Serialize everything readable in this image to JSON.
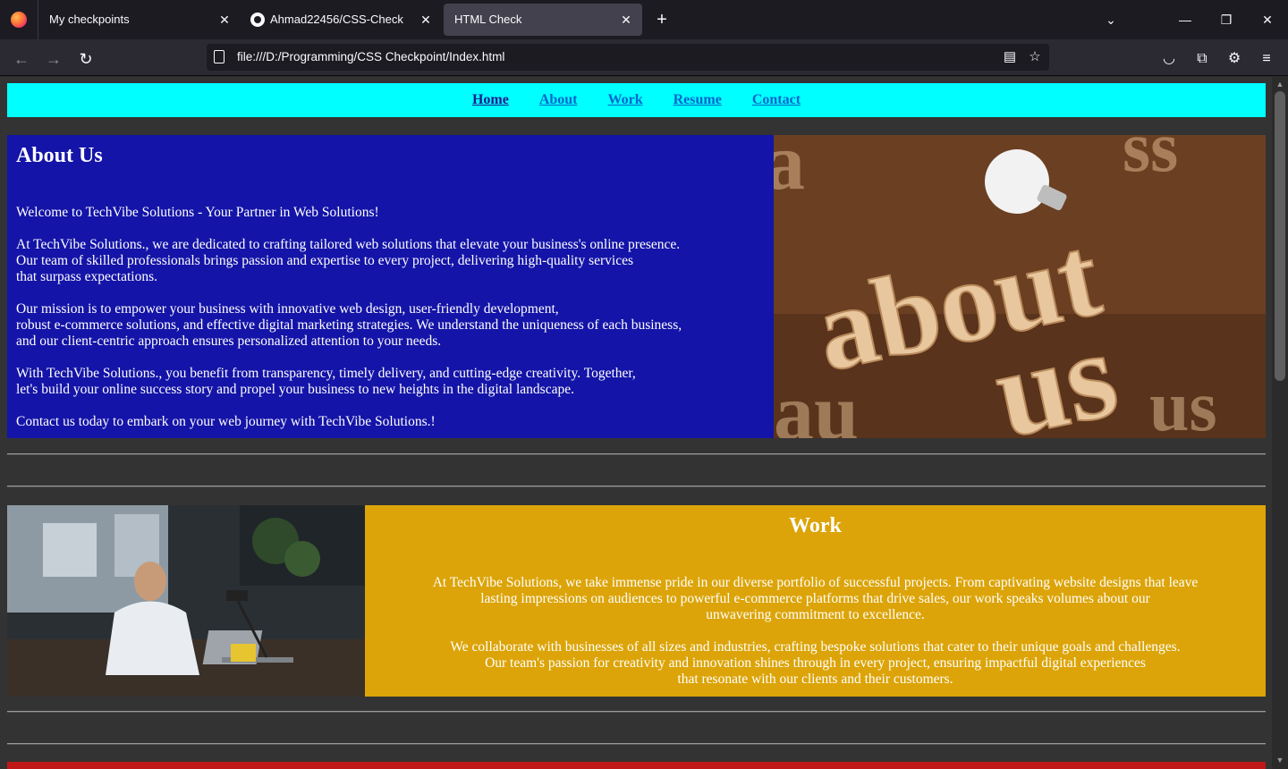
{
  "browser": {
    "tabs": [
      {
        "title": "My checkpoints"
      },
      {
        "title": "Ahmad22456/CSS-Check"
      },
      {
        "title": "HTML Check"
      }
    ],
    "url": "file:///D:/Programming/CSS Checkpoint/Index.html"
  },
  "site": {
    "nav": [
      "Home",
      "About",
      "Work",
      "Resume",
      "Contact"
    ],
    "about": {
      "heading": "About Us",
      "p1": "Welcome to TechVibe Solutions - Your Partner in Web Solutions!",
      "p2": [
        "At TechVibe Solutions., we are dedicated to crafting tailored web solutions that elevate your business's online presence.",
        "Our team of skilled professionals brings passion and expertise to every project, delivering high-quality services",
        "that surpass expectations."
      ],
      "p3": [
        "Our mission is to empower your business with innovative web design, user-friendly development,",
        "robust e-commerce solutions, and effective digital marketing strategies. We understand the uniqueness of each business,",
        "and our client-centric approach ensures personalized attention to your needs."
      ],
      "p4": [
        "With TechVibe Solutions., you benefit from transparency, timely delivery, and cutting-edge creativity. Together,",
        "let's build your online success story and propel your business to new heights in the digital landscape."
      ],
      "p5": "Contact us today to embark on your web journey with TechVibe Solutions.!",
      "image_text": [
        "about",
        "us"
      ]
    },
    "work": {
      "heading": "Work",
      "p1": [
        "At TechVibe Solutions, we take immense pride in our diverse portfolio of successful projects. From captivating website designs that leave",
        "lasting impressions on audiences to powerful e-commerce platforms that drive sales, our work speaks volumes about our",
        "unwavering commitment to excellence."
      ],
      "p2": [
        "We collaborate with businesses of all sizes and industries, crafting bespoke solutions that cater to their unique goals and challenges.",
        "Our team's passion for creativity and innovation shines through in every project, ensuring impactful digital experiences",
        "that resonate with our clients and their customers."
      ]
    }
  }
}
